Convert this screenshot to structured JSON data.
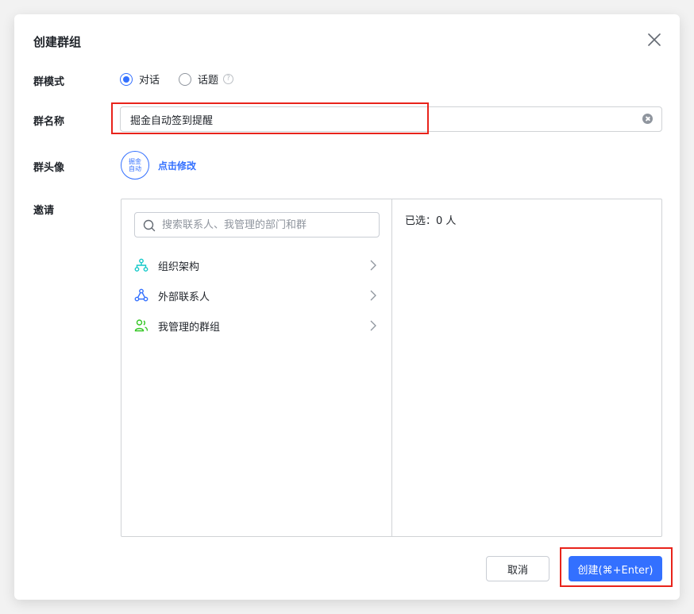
{
  "dialog": {
    "title": "创建群组",
    "close_icon": "close-icon"
  },
  "mode": {
    "label": "群模式",
    "options": [
      {
        "label": "对话",
        "selected": true
      },
      {
        "label": "话题",
        "selected": false
      }
    ],
    "help_icon": "question-circle-icon"
  },
  "name": {
    "label": "群名称",
    "value": "掘金自动签到提醒",
    "clear_icon": "clear-circle-icon"
  },
  "avatar": {
    "label": "群头像",
    "avatar_text_line1": "掘金",
    "avatar_text_line2": "自动",
    "edit_link": "点击修改"
  },
  "invite": {
    "label": "邀请",
    "search_placeholder": "搜索联系人、我管理的部门和群",
    "items": [
      {
        "label": "组织架构",
        "icon": "org-chart-icon"
      },
      {
        "label": "外部联系人",
        "icon": "external-contacts-icon"
      },
      {
        "label": "我管理的群组",
        "icon": "managed-groups-icon"
      }
    ],
    "selected_count": "已选：0 人"
  },
  "footer": {
    "cancel_label": "取消",
    "create_label": "创建(⌘+Enter)"
  },
  "colors": {
    "accent": "#3370ff",
    "highlight": "#e8231b"
  }
}
